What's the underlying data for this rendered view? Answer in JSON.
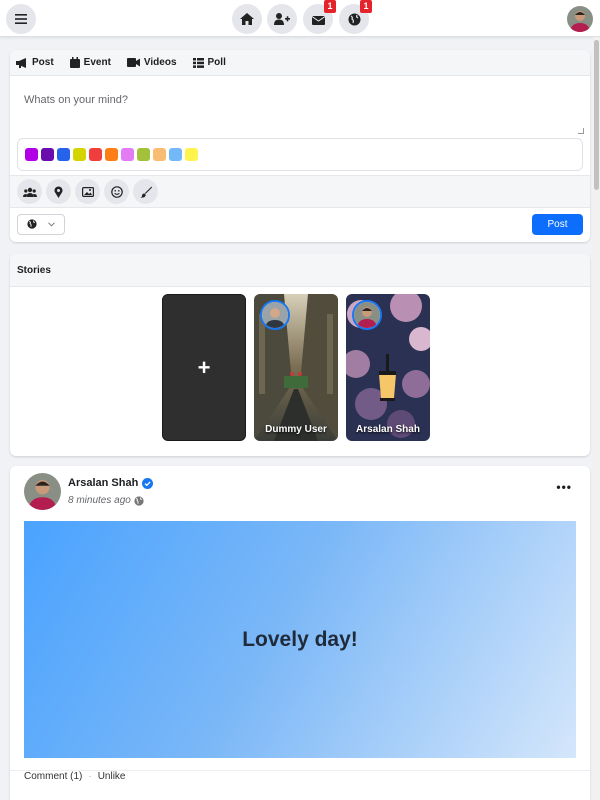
{
  "topbar": {
    "menu_icon": "hamburger-icon",
    "nav": [
      {
        "icon": "home-icon",
        "badge": ""
      },
      {
        "icon": "add-friend-icon",
        "badge": ""
      },
      {
        "icon": "messages-icon",
        "badge": "1"
      },
      {
        "icon": "globe-icon",
        "badge": "1"
      }
    ],
    "avatar": "user-avatar"
  },
  "composer": {
    "tabs": [
      {
        "label": "Post",
        "icon": "megaphone-icon"
      },
      {
        "label": "Event",
        "icon": "calendar-icon"
      },
      {
        "label": "Videos",
        "icon": "video-icon"
      },
      {
        "label": "Poll",
        "icon": "poll-icon"
      }
    ],
    "placeholder": "Whats on your mind?",
    "colors": [
      "#b200e6",
      "#6a0dad",
      "#2563eb",
      "#d4d400",
      "#f03e3e",
      "#fd7e14",
      "#e37bf4",
      "#a3c13a",
      "#f8bc73",
      "#74b9f7",
      "#fff34d"
    ],
    "tools": [
      "group-icon",
      "location-icon",
      "image-icon",
      "smile-icon",
      "brush-icon"
    ],
    "privacy_icon": "globe-icon",
    "post_label": "Post"
  },
  "stories": {
    "title": "Stories",
    "add_label": "+",
    "items": [
      {
        "name": "Dummy User"
      },
      {
        "name": "Arsalan Shah"
      }
    ]
  },
  "feed": {
    "author": "Arsalan Shah",
    "verified": "verified-icon",
    "time": "8 minutes ago",
    "banner_text": "Lovely day!",
    "comment_label": "Comment (1)",
    "unlike_label": "Unlike",
    "more_label": "•••"
  }
}
